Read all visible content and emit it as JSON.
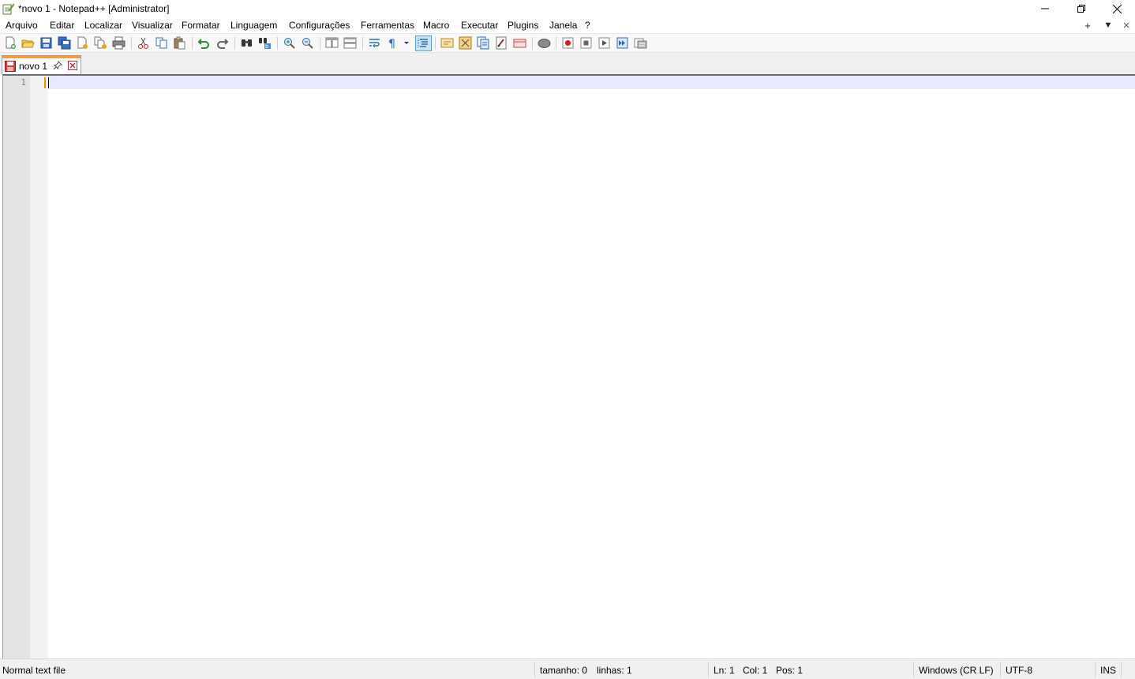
{
  "window": {
    "title": "*novo 1 - Notepad++ [Administrator]"
  },
  "menu": {
    "items": [
      "Arquivo",
      "Editar",
      "Localizar",
      "Visualizar",
      "Formatar",
      "Linguagem",
      "Configurações",
      "Ferramentas",
      "Macro",
      "Executar",
      "Plugins",
      "Janela",
      "?"
    ],
    "right_glyphs": [
      "+",
      "▼",
      "✕"
    ]
  },
  "toolbar": {
    "icons": [
      "new-file-icon",
      "open-file-icon",
      "save-icon",
      "save-all-icon",
      "close-icon",
      "close-all-icon",
      "print-icon",
      "cut-icon",
      "copy-icon",
      "paste-icon",
      "undo-icon",
      "redo-icon",
      "find-icon",
      "replace-icon",
      "zoom-in-icon",
      "zoom-out-icon",
      "sync-vertical-icon",
      "sync-horizontal-icon",
      "word-wrap-icon",
      "show-all-characters-icon",
      "indent-guide-icon",
      "user-defined-language-icon",
      "document-map-icon",
      "function-list-icon",
      "folder-workspace-icon",
      "monitoring-icon",
      "record-macro-icon",
      "stop-recording-icon",
      "playback-macro-icon",
      "run-macro-multiple-icon",
      "save-macro-icon"
    ]
  },
  "tabs": [
    {
      "label": "novo 1",
      "modified": true
    }
  ],
  "editor": {
    "line_numbers": [
      "1"
    ],
    "content": ""
  },
  "status": {
    "file_type": "Normal text file",
    "length": "tamanho: 0",
    "lines": "linhas: 1",
    "ln": "Ln: 1",
    "col": "Col: 1",
    "pos": "Pos: 1",
    "eol": "Windows (CR LF)",
    "encoding": "UTF-8",
    "mode": "INS"
  },
  "colors": {
    "tab_accent": "#fa9e2f",
    "current_line": "#e8e8ff",
    "caret": "#ff8c00"
  }
}
